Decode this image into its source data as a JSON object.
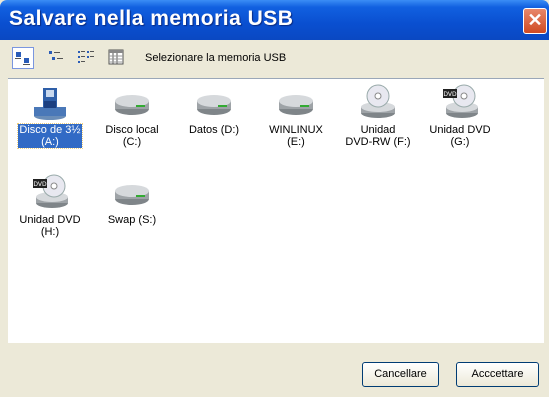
{
  "window": {
    "title": "Salvare nella memoria USB",
    "close_glyph": "✕"
  },
  "toolbar": {
    "buttons": [
      {
        "icon": "large-icons-view-icon",
        "active": true
      },
      {
        "icon": "small-icons-view-icon",
        "active": false
      },
      {
        "icon": "list-view-icon",
        "active": false
      },
      {
        "icon": "details-view-icon",
        "active": false
      }
    ],
    "label": "Selezionare la memoria USB"
  },
  "drives": [
    {
      "label": "Disco de 3½\n(A:)",
      "icon": "floppy-drive-icon",
      "selected": true
    },
    {
      "label": "Disco local (C:)",
      "icon": "hard-drive-icon",
      "selected": false
    },
    {
      "label": "Datos (D:)",
      "icon": "hard-drive-icon",
      "selected": false
    },
    {
      "label": "WINLINUX\n(E:)",
      "icon": "hard-drive-icon",
      "selected": false
    },
    {
      "label": "Unidad\nDVD-RW (F:)",
      "icon": "cd-drive-icon",
      "selected": false
    },
    {
      "label": "Unidad DVD\n(G:)",
      "icon": "dvd-drive-icon",
      "selected": false
    },
    {
      "label": "Unidad DVD\n(H:)",
      "icon": "dvd-drive-icon",
      "selected": false
    },
    {
      "label": "Swap (S:)",
      "icon": "hard-drive-icon",
      "selected": false
    }
  ],
  "footer": {
    "cancel_label": "Cancellare",
    "accept_label": "Acccettare"
  },
  "colors": {
    "title_bar": "#0a4fd0",
    "selection": "#316ac5",
    "window_bg": "#ece9d8"
  }
}
